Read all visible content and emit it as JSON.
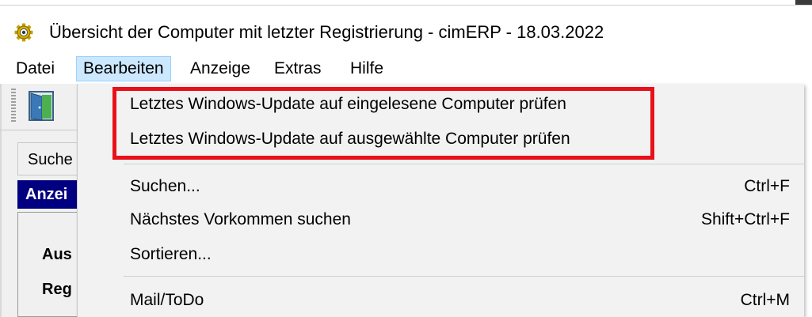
{
  "window": {
    "title": "Übersicht der Computer mit letzter Registrierung - cimERP - 18.03.2022",
    "icon": "gear-icon"
  },
  "menubar": {
    "items": [
      {
        "label": "Datei"
      },
      {
        "label": "Bearbeiten",
        "active": true
      },
      {
        "label": "Anzeige"
      },
      {
        "label": "Extras"
      },
      {
        "label": "Hilfe"
      }
    ]
  },
  "toolbar": {
    "icons": [
      "door-exit-icon"
    ]
  },
  "left_panel": {
    "search_tab_label": "Suche",
    "header_label": "Anzei",
    "labels": [
      "Aus",
      "Reg"
    ]
  },
  "dropdown": {
    "items": [
      {
        "label": "Letztes Windows-Update auf eingelesene Computer prüfen",
        "shortcut": ""
      },
      {
        "label": "Letztes Windows-Update auf ausgewählte Computer prüfen",
        "shortcut": ""
      },
      {
        "label": "Suchen...",
        "shortcut": "Ctrl+F"
      },
      {
        "label": "Nächstes Vorkommen suchen",
        "shortcut": "Shift+Ctrl+F"
      },
      {
        "label": "Sortieren...",
        "shortcut": ""
      },
      {
        "label": "Mail/ToDo",
        "shortcut": "Ctrl+M"
      }
    ]
  },
  "colors": {
    "highlight_box": "#e8111a",
    "menu_active_bg": "#cce8ff",
    "panel_header_bg": "#000080"
  }
}
